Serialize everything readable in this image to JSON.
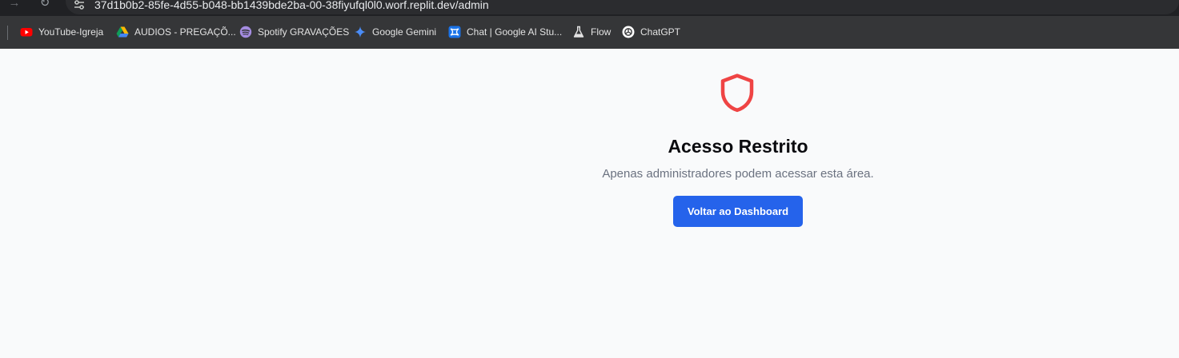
{
  "browser": {
    "url": "37d1b0b2-85fe-4d55-b048-bb1439bde2ba-00-38fiyufql0l0.worf.replit.dev/admin",
    "back_icon": "arrow-right-icon",
    "reload_icon": "reload-icon",
    "site_info_icon": "tune-icon"
  },
  "bookmarks": [
    {
      "label": "YouTube-Igreja",
      "icon": "youtube-icon",
      "color": "#ff0000"
    },
    {
      "label": "AUDIOS - PREGAÇÕ...",
      "icon": "google-drive-icon",
      "color": "#4285f4"
    },
    {
      "label": "Spotify GRAVAÇÕES",
      "icon": "spotify-icon",
      "color": "#a48ce0"
    },
    {
      "label": "Google Gemini",
      "icon": "gemini-icon",
      "color": "#4a8cf7"
    },
    {
      "label": "Chat | Google AI Stu...",
      "icon": "ai-studio-icon",
      "color": "#4285f4"
    },
    {
      "label": "Flow",
      "icon": "flask-icon",
      "color": "#e3e3e3"
    },
    {
      "label": "ChatGPT",
      "icon": "chatgpt-icon",
      "color": "#ffffff"
    }
  ],
  "page": {
    "icon": "shield-icon",
    "icon_color": "#ef4444",
    "title": "Acesso Restrito",
    "message": "Apenas administradores podem acessar esta área.",
    "button_label": "Voltar ao Dashboard",
    "button_color": "#2563eb"
  }
}
